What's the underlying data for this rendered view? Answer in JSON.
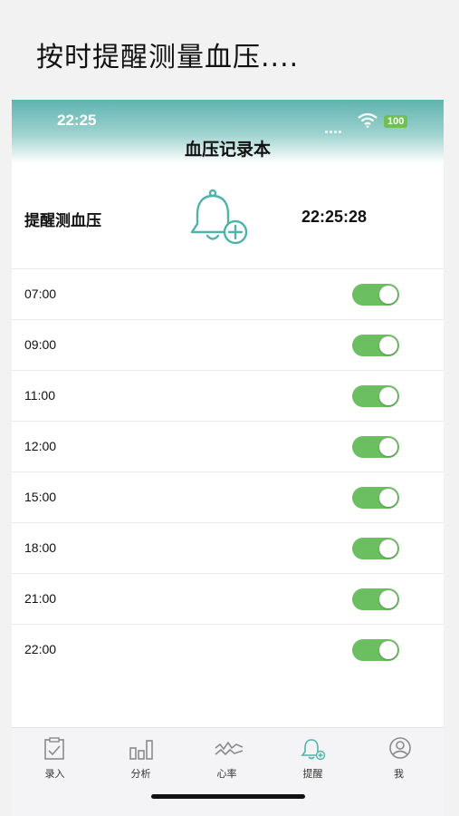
{
  "promo": {
    "caption": "按时提醒测量血压...."
  },
  "status_bar": {
    "time": "22:25",
    "battery": "100"
  },
  "header": {
    "title": "血压记录本"
  },
  "reminder": {
    "label": "提醒测血压",
    "current_time": "22:25:28",
    "add_icon": "bell-add-icon"
  },
  "alarms": [
    {
      "time": "07:00",
      "enabled": true
    },
    {
      "time": "09:00",
      "enabled": true
    },
    {
      "time": "11:00",
      "enabled": true
    },
    {
      "time": "12:00",
      "enabled": true
    },
    {
      "time": "15:00",
      "enabled": true
    },
    {
      "time": "18:00",
      "enabled": true
    },
    {
      "time": "21:00",
      "enabled": true
    },
    {
      "time": "22:00",
      "enabled": true
    }
  ],
  "tabs": [
    {
      "label": "录入",
      "icon": "clipboard-icon"
    },
    {
      "label": "分析",
      "icon": "bar-chart-icon"
    },
    {
      "label": "心率",
      "icon": "heartbeat-icon"
    },
    {
      "label": "提醒",
      "icon": "bell-icon",
      "active": true
    },
    {
      "label": "我",
      "icon": "user-icon"
    }
  ],
  "colors": {
    "accent": "#4fb3ab",
    "toggle_on": "#6cbf61",
    "header_top": "#5fb3b0"
  }
}
